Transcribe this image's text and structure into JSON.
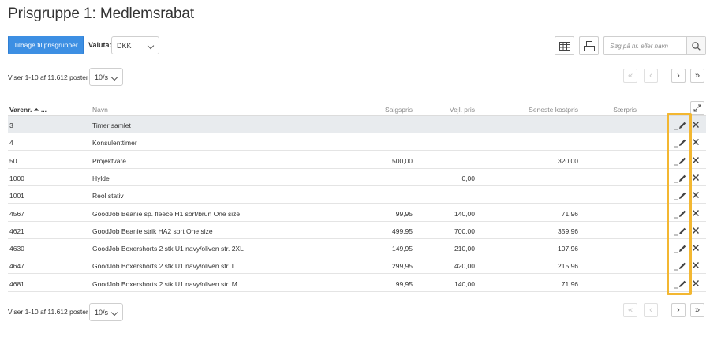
{
  "page": {
    "title": "Prisgruppe 1: Medlemsrabat"
  },
  "toolbar": {
    "back_label": "Tilbage til prisgrupper",
    "valuta_label": "Valuta:",
    "valuta_value": "DKK",
    "search_placeholder": "Søg på nr. eller navn"
  },
  "pagination": {
    "info": "Viser 1-10 af 11.612 poster",
    "per_page": "10/s",
    "first": "«",
    "prev": "‹",
    "next": "›",
    "last": "»"
  },
  "table": {
    "columns": {
      "varenr": "Varenr. ⏶ ...",
      "navn": "Navn",
      "salgspris": "Salgspris",
      "vejl_pris": "Vejl. pris",
      "seneste_kostpris": "Seneste kostpris",
      "saerpris": "Særpris"
    },
    "rows": [
      {
        "varenr": "3",
        "navn": "Timer samlet",
        "salgspris": "",
        "vejl_pris": "",
        "kostpris": "",
        "saerpris": ""
      },
      {
        "varenr": "4",
        "navn": "Konsulenttimer",
        "salgspris": "",
        "vejl_pris": "",
        "kostpris": "",
        "saerpris": ""
      },
      {
        "varenr": "50",
        "navn": "Projektvare",
        "salgspris": "500,00",
        "vejl_pris": "",
        "kostpris": "320,00",
        "saerpris": ""
      },
      {
        "varenr": "1000",
        "navn": "Hylde",
        "salgspris": "",
        "vejl_pris": "0,00",
        "kostpris": "",
        "saerpris": ""
      },
      {
        "varenr": "1001",
        "navn": "Reol stativ",
        "salgspris": "",
        "vejl_pris": "",
        "kostpris": "",
        "saerpris": ""
      },
      {
        "varenr": "4567",
        "navn": "GoodJob Beanie sp. fleece H1 sort/brun One size",
        "salgspris": "99,95",
        "vejl_pris": "140,00",
        "kostpris": "71,96",
        "saerpris": ""
      },
      {
        "varenr": "4621",
        "navn": "GoodJob Beanie strik HA2 sort One size",
        "salgspris": "499,95",
        "vejl_pris": "700,00",
        "kostpris": "359,96",
        "saerpris": ""
      },
      {
        "varenr": "4630",
        "navn": "GoodJob Boxershorts 2 stk U1 navy/oliven str. 2XL",
        "salgspris": "149,95",
        "vejl_pris": "210,00",
        "kostpris": "107,96",
        "saerpris": ""
      },
      {
        "varenr": "4647",
        "navn": "GoodJob Boxershorts 2 stk U1 navy/oliven str. L",
        "salgspris": "299,95",
        "vejl_pris": "420,00",
        "kostpris": "215,96",
        "saerpris": ""
      },
      {
        "varenr": "4681",
        "navn": "GoodJob Boxershorts 2 stk U1 navy/oliven str. M",
        "salgspris": "99,95",
        "vejl_pris": "140,00",
        "kostpris": "71,96",
        "saerpris": ""
      }
    ]
  },
  "icons": {
    "table_view": "table-icon",
    "print": "print-icon",
    "search": "search-icon",
    "expand": "expand-icon",
    "edit": "pencil-icon",
    "delete": "close-icon"
  },
  "colors": {
    "primary": "#3d8fe3",
    "highlight_box": "#f3b731",
    "row_highlight": "#e8ebee"
  }
}
